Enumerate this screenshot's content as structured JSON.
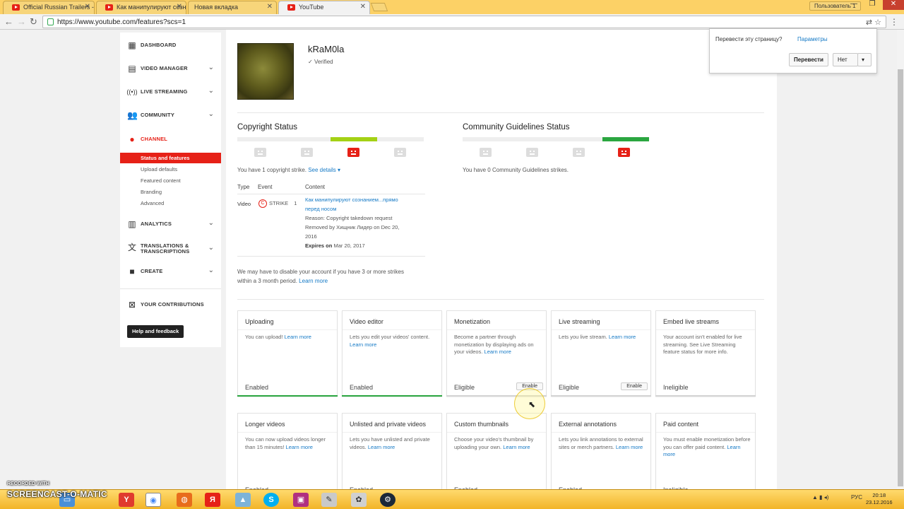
{
  "browser": {
    "tabs": [
      {
        "label": "Official Russian Trailers -"
      },
      {
        "label": "Как манипулируют созн"
      },
      {
        "label": "Новая вкладка"
      },
      {
        "label": "YouTube"
      }
    ],
    "user_chip": "Пользователь 1",
    "url": "https://www.youtube.com/features?scs=1"
  },
  "sidebar": {
    "items": [
      {
        "label": "DASHBOARD",
        "icon": "dashboard-icon"
      },
      {
        "label": "VIDEO MANAGER",
        "icon": "video-manager-icon"
      },
      {
        "label": "LIVE STREAMING",
        "icon": "live-streaming-icon"
      },
      {
        "label": "COMMUNITY",
        "icon": "community-icon"
      },
      {
        "label": "CHANNEL",
        "icon": "channel-icon"
      }
    ],
    "channel_sub": [
      {
        "label": "Status and features"
      },
      {
        "label": "Upload defaults"
      },
      {
        "label": "Featured content"
      },
      {
        "label": "Branding"
      },
      {
        "label": "Advanced"
      }
    ],
    "items2": [
      {
        "label": "ANALYTICS",
        "icon": "analytics-icon"
      },
      {
        "label": "TRANSLATIONS &",
        "label2": "TRANSCRIPTIONS",
        "icon": "translate-icon"
      },
      {
        "label": "CREATE",
        "icon": "create-icon"
      },
      {
        "label": "YOUR CONTRIBUTIONS",
        "icon": "contributions-icon"
      }
    ],
    "help_button": "Help and feedback"
  },
  "channel": {
    "name": "kRaM0la",
    "verified": "Verified"
  },
  "copyright": {
    "title": "Copyright Status",
    "strikes_text": "You have 1 copyright strike.",
    "see_details": "See details",
    "table_headers": [
      "Type",
      "Event",
      "Content"
    ],
    "row": {
      "type": "Video",
      "event": "STRIKE",
      "event_count": "1",
      "content_link1": "Как манипулируют сознанием...прямо",
      "content_link2": "перед носом",
      "reason": "Reason: Copyright takedown request",
      "removed1": "Removed by Хищник Лидер on Dec 20,",
      "removed2": "2016",
      "expires_label": "Expires on",
      "expires_date": "Mar 20, 2017"
    },
    "warning1": "We may have to disable your account if you have 3 or more strikes",
    "warning2": "within a 3 month period.",
    "learn_more": "Learn more"
  },
  "community": {
    "title": "Community Guidelines Status",
    "strikes_text": "You have 0 Community Guidelines strikes."
  },
  "features": [
    {
      "title": "Uploading",
      "desc": "You can upload!",
      "link": "Learn more",
      "status": "Enabled",
      "bar": "green"
    },
    {
      "title": "Video editor",
      "desc": "Lets you edit your videos' content.",
      "link": "Learn more",
      "status": "Enabled",
      "bar": "green"
    },
    {
      "title": "Monetization",
      "desc": "Become a partner through monetization by displaying ads on your videos.",
      "link": "Learn more",
      "status": "Eligible",
      "button": "Enable",
      "bar": "grey"
    },
    {
      "title": "Live streaming",
      "desc": "Lets you live stream.",
      "link": "Learn more",
      "status": "Eligible",
      "button": "Enable",
      "bar": "grey"
    },
    {
      "title": "Embed live streams",
      "desc": "Your account isn't enabled for live streaming. See Live Streaming feature status for more info.",
      "link": "",
      "status": "Ineligible",
      "bar": "grey"
    },
    {
      "title": "Longer videos",
      "desc": "You can now upload videos longer than 15 minutes!",
      "link": "Learn more",
      "status": "Enabled",
      "bar": "green"
    },
    {
      "title": "Unlisted and private videos",
      "desc": "Lets you have unlisted and private videos.",
      "link": "Learn more",
      "status": "Enabled",
      "bar": "green"
    },
    {
      "title": "Custom thumbnails",
      "desc": "Choose your video's thumbnail by uploading your own.",
      "link": "Learn more",
      "status": "Enabled",
      "bar": "green"
    },
    {
      "title": "External annotations",
      "desc": "Lets you link annotations to external sites or merch partners.",
      "link": "Learn more",
      "status": "Enabled",
      "bar": "green"
    },
    {
      "title": "Paid content",
      "desc": "You must enable monetization before you can offer paid content.",
      "link": "Learn more",
      "status": "Ineligible",
      "bar": "grey"
    }
  ],
  "translate_popup": {
    "question": "Перевести эту страницу?",
    "params": "Параметры",
    "translate_btn": "Перевести",
    "no_btn": "Нет"
  },
  "taskbar": {
    "watermark_top": "RECORDED WITH",
    "watermark_main": "SCREENCAST-O-MATIC",
    "lang": "РУС",
    "time": "20:18",
    "date": "23.12.2016"
  },
  "colors": {
    "youtube_red": "#e62117",
    "strike_green": "#2ba640",
    "strike_yellow_green": "#a4d115",
    "link_blue": "#167ac6"
  }
}
